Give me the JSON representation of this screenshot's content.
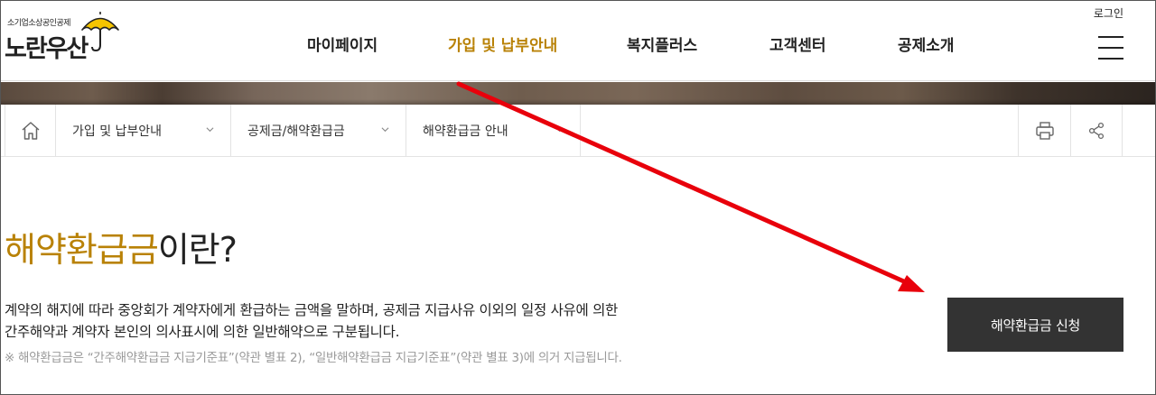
{
  "header": {
    "logo_sub": "소기업소상공인공제",
    "logo_main": "노란우산",
    "login": "로그인",
    "nav": [
      {
        "label": "마이페이지",
        "active": false
      },
      {
        "label": "가입 및 납부안내",
        "active": true
      },
      {
        "label": "복지플러스",
        "active": false
      },
      {
        "label": "고객센터",
        "active": false
      },
      {
        "label": "공제소개",
        "active": false
      }
    ]
  },
  "breadcrumb": {
    "items": [
      {
        "label": "가입 및 납부안내"
      },
      {
        "label": "공제금/해약환급금"
      },
      {
        "label": "해약환급금 안내"
      }
    ]
  },
  "icons": {
    "home": "home-icon",
    "print": "print-icon",
    "share": "share-icon",
    "menu": "hamburger-icon",
    "logo": "umbrella-icon"
  },
  "main": {
    "title_highlight": "해약환급금",
    "title_rest": "이란?",
    "desc_line1": "계약의 해지에 따라 중앙회가 계약자에게 환급하는 금액을 말하며, 공제금 지급사유 이외의 일정 사유에 의한",
    "desc_line2": "간주해약과 계약자 본인의 의사표시에 의한 일반해약으로 구분됩니다.",
    "note": "※ 해약환급금은 “간주해약환급금 지급기준표”(약관 별표 2), “일반해약환급금 지급기준표”(약관 별표 3)에 의거 지급됩니다.",
    "apply_button": "해약환급금 신청"
  },
  "colors": {
    "accent": "#b98207",
    "button_bg": "#333333",
    "annotation_arrow": "#e8000b"
  }
}
